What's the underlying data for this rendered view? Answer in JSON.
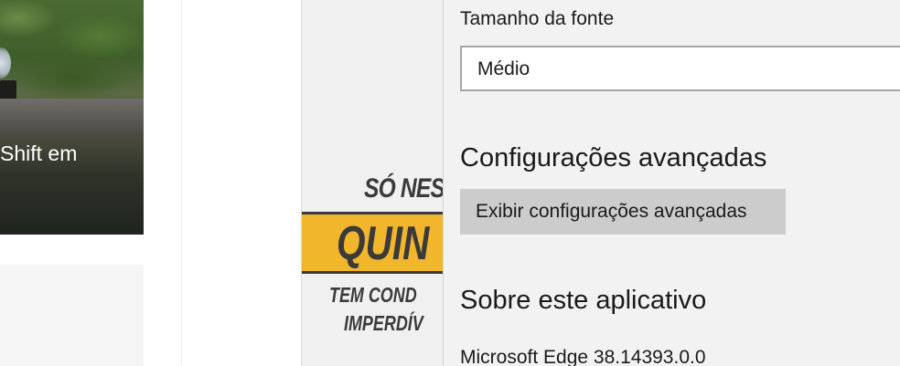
{
  "news_card": {
    "caption": "Shift em"
  },
  "ad": {
    "line1": "SÓ NES",
    "line2": "QUIN",
    "line3": "TEM COND",
    "line4": "IMPERDÍV"
  },
  "settings": {
    "font_size_label": "Tamanho da fonte",
    "font_size_value": "Médio",
    "advanced_heading": "Configurações avançadas",
    "advanced_button": "Exibir configurações avançadas",
    "about_heading": "Sobre este aplicativo",
    "version": "Microsoft Edge 38.14393.0.0"
  }
}
